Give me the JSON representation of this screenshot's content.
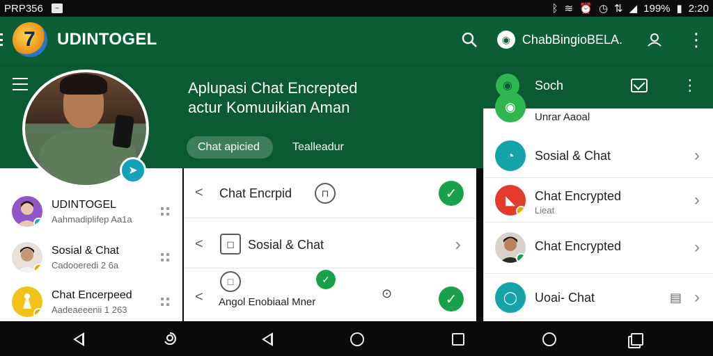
{
  "status_bar": {
    "carrier": "PRP356",
    "battery": "199%",
    "time": "2:20",
    "icons": [
      "notification-icon",
      "bluetooth-icon",
      "wifi-icon",
      "alarm-icon",
      "clock-icon",
      "data-icon",
      "signal-icon",
      "battery-icon"
    ]
  },
  "app_bar": {
    "title": "UDINTOGEL",
    "chat_label": "ChabBingioBELA.",
    "icons": [
      "logo-icon",
      "search-icon",
      "chat-bubble-icon",
      "profile-icon",
      "more-vert-icon"
    ]
  },
  "hero": {
    "title": "Aplupasi Chat Encrepted",
    "subtitle": "actur Komuuikian Aman",
    "chips": [
      {
        "label": "Chat apicied",
        "active": true
      },
      {
        "label": "Tealleadur",
        "active": false
      }
    ]
  },
  "left_list": [
    {
      "name": "UDINTOGEL",
      "sub": "Aahmadiplifep Aa1a",
      "badge_color": "#1ba6d6",
      "avatar_color": "#8e56c8"
    },
    {
      "name": "Sosial & Chat",
      "sub": "Cadooeredi 2 6a",
      "badge_color": "#f0a800",
      "avatar_color": "#e8e1da"
    },
    {
      "name": "Chat Encerpeed",
      "sub": "Aadeaeeenii 1 263",
      "badge_color": "#f0a800",
      "avatar_color": "#f2c21a"
    }
  ],
  "middle_card": {
    "rows": [
      {
        "label": "Chat Encrpid",
        "icon": "lock-circle-icon",
        "status": "check"
      },
      {
        "label": "Sosial & Chat",
        "icon": "chat-square-icon",
        "status": "chevron"
      },
      {
        "label": "Angol Enobiaal Mner",
        "icon": "chat-outline-icon",
        "status": "check"
      }
    ]
  },
  "right_panel": {
    "header_title": "Soch",
    "items": [
      {
        "title": "Unrar Aaoal",
        "sub": "",
        "icon_color": "#2fb64e"
      },
      {
        "title": "Sosial & Chat",
        "sub": "",
        "icon_color": "#14a3a8"
      },
      {
        "title": "Chat Encrypted",
        "sub": "Lieat",
        "icon_color": "#e23b2b"
      },
      {
        "title": "Chat Encrypted",
        "sub": "",
        "icon_color": "#2a2a2a"
      },
      {
        "title": "Uoai- Chat",
        "sub": "",
        "icon_color": "#14a3a8"
      }
    ]
  },
  "nav_bar": {
    "icons": [
      "back-icon",
      "assistant-icon",
      "back-icon",
      "home-icon",
      "recents-icon",
      "circle-icon",
      "overview-icon"
    ]
  },
  "colors": {
    "brand_green": "#0b5e36",
    "accent_teal": "#12a3b8",
    "check_green": "#18a14a"
  }
}
